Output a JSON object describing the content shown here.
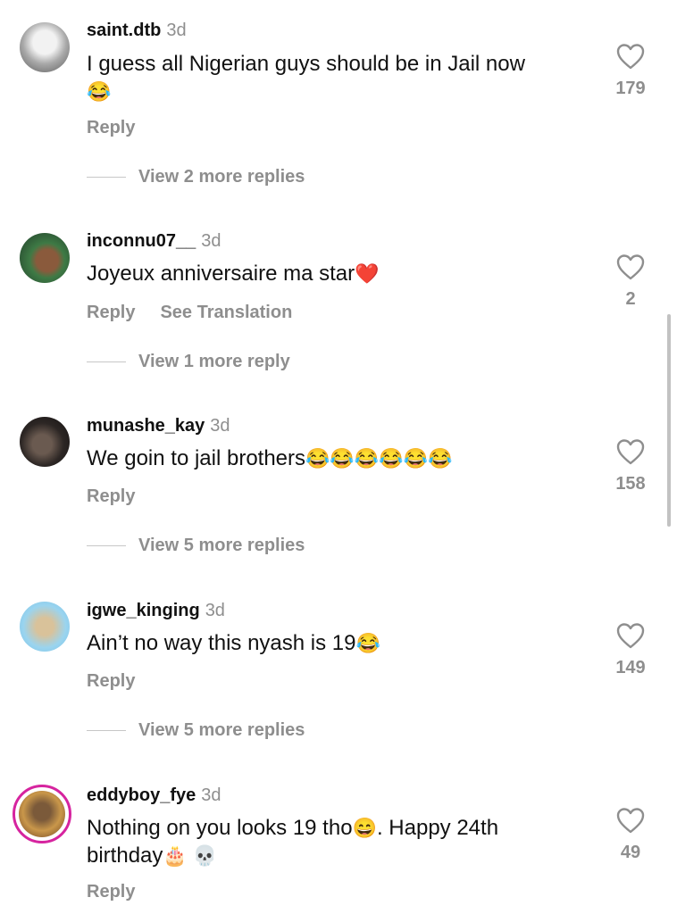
{
  "comments": [
    {
      "username": "saint.dtb",
      "time": "3d",
      "text": "I guess all Nigerian guys should be in Jail now",
      "emoji": "😂",
      "likes": "179",
      "reply_label": "Reply",
      "view_replies": "View 2 more replies"
    },
    {
      "username": "inconnu07__",
      "time": "3d",
      "text": "Joyeux anniversaire ma star",
      "emoji": "❤️",
      "likes": "2",
      "reply_label": "Reply",
      "translation_label": "See Translation",
      "view_replies": "View 1 more reply"
    },
    {
      "username": "munashe_kay",
      "time": "3d",
      "text": "We goin to jail brothers",
      "emoji": "😂😂😂😂😂😂",
      "likes": "158",
      "reply_label": "Reply",
      "view_replies": "View 5 more replies"
    },
    {
      "username": "igwe_kinging",
      "time": "3d",
      "text": "Ain’t no way this nyash is 19",
      "emoji": "😂",
      "likes": "149",
      "reply_label": "Reply",
      "view_replies": "View 5 more replies"
    },
    {
      "username": "eddyboy_fye",
      "time": "3d",
      "text_a": "Nothing on you looks 19 tho",
      "emoji_a": "😄",
      "text_b": ". Happy 24th birthday",
      "emoji_b": "🎂 💀",
      "likes": "49",
      "reply_label": "Reply"
    }
  ],
  "icons": {
    "like": "heart-outline-icon"
  },
  "colors": {
    "secondary_text": "#8e8e8e",
    "story_ring": "#d6249f"
  }
}
